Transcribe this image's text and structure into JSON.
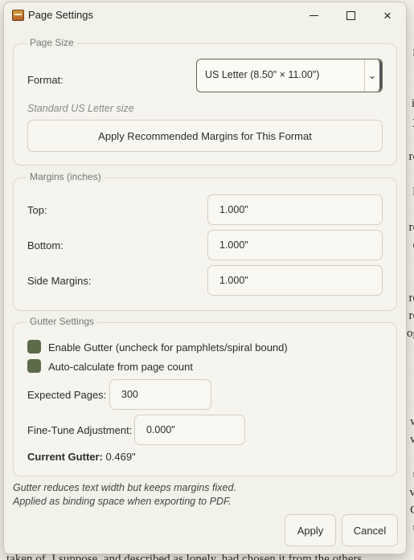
{
  "background_text": {
    "right_edge_lines": [
      "e",
      "g",
      "a",
      "c",
      "ir",
      "y",
      "c",
      "ro",
      "c",
      "h",
      "c",
      "ro",
      "o",
      "c",
      "e",
      "ro",
      "ro",
      "og",
      "c",
      "c",
      "s",
      "a",
      "w",
      "w",
      "c",
      "u",
      "vi",
      "G",
      "u"
    ],
    "bottom_line": "taken of, I suppose, and described as lonely, had chosen it from the others"
  },
  "window": {
    "title": "Page Settings",
    "icon": "app-book-icon",
    "controls": {
      "minimize": "minimize-icon",
      "maximize": "maximize-icon",
      "close": "×"
    }
  },
  "page_size": {
    "title": "Page Size",
    "format_label": "Format:",
    "format_value": "US Letter (8.50\" × 11.00\")",
    "format_hint": "Standard US Letter size",
    "apply_margins_button": "Apply Recommended Margins for This Format"
  },
  "margins": {
    "title": "Margins (inches)",
    "top_label": "Top:",
    "top_value": "1.000\"",
    "bottom_label": "Bottom:",
    "bottom_value": "1.000\"",
    "side_label": "Side Margins:",
    "side_value": "1.000\""
  },
  "gutter": {
    "title": "Gutter Settings",
    "enable_label": "Enable Gutter (uncheck for pamphlets/spiral bound)",
    "enable_checked": true,
    "auto_label": "Auto-calculate from page count",
    "auto_checked": true,
    "pages_label": "Expected Pages:",
    "pages_value": "300",
    "finetune_label": "Fine-Tune Adjustment:",
    "finetune_value": "0.000\"",
    "current_label": "Current Gutter:",
    "current_value": "0.469\""
  },
  "footer": {
    "note_line1": "Gutter reduces text width but keeps margins fixed.",
    "note_line2": "Applied as binding space when exporting to PDF.",
    "apply_button": "Apply",
    "cancel_button": "Cancel"
  },
  "colors": {
    "accent": "#5c6b4a",
    "dialog_bg": "#f2f1ea"
  }
}
